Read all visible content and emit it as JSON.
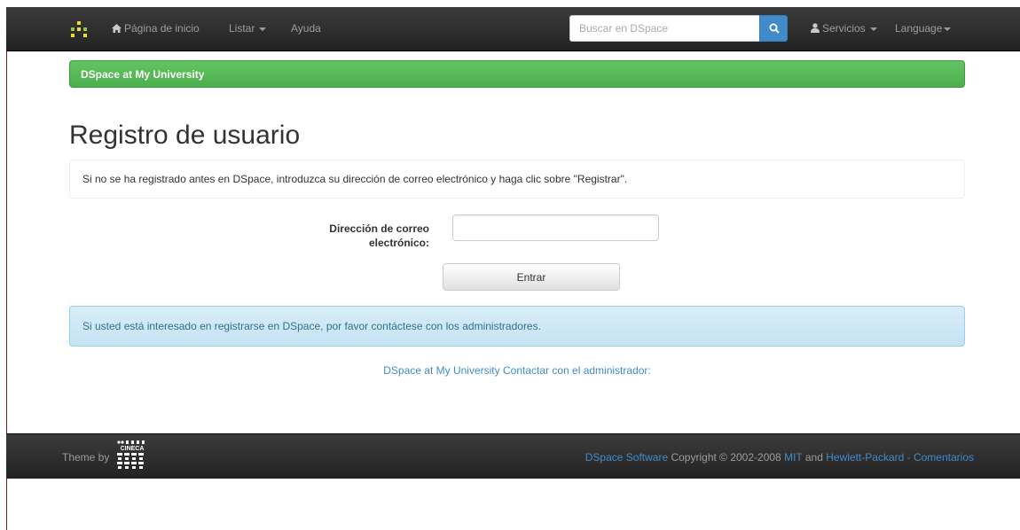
{
  "navbar": {
    "home_label": "Página de inicio",
    "browse_label": "Listar",
    "help_label": "Ayuda",
    "search_placeholder": "Buscar en DSpace",
    "services_label": "Servicios",
    "language_label": "Language"
  },
  "banner": {
    "text": "DSpace at My University"
  },
  "page": {
    "title": "Registro de usuario",
    "instructions": "Si no se ha registrado antes en DSpace, introduzca su dirección de correo electrónico y haga clic sobre \"Registrar\".",
    "email_label_line1": "Dirección de correo",
    "email_label_line2": "electrónico:",
    "email_value": "",
    "submit_label": "Entrar",
    "info_alert": "Si usted está interesado en registrarse en DSpace, por favor contáctese con los administradores.",
    "admin_site_link": "DSpace at My University",
    "admin_contact_link": "Contactar con el administrador:"
  },
  "footer": {
    "theme_by": "Theme by",
    "logo_text": "CINECA",
    "dspace_link": "DSpace Software",
    "copyright": "Copyright © 2002-2008",
    "mit_link": "MIT",
    "and_text": "and",
    "hp_link": "Hewlett-Packard",
    "separator": "-",
    "feedback_link": "Comentarios"
  },
  "colors": {
    "navbar_bg": "#222222",
    "banner_green": "#5cb85c",
    "link_blue": "#428bca",
    "alert_info_bg": "#d9edf7",
    "alert_info_text": "#31708f"
  },
  "icons": [
    "dspace-logo-icon",
    "home-icon",
    "search-icon",
    "user-icon",
    "cineca-logo-icon"
  ]
}
